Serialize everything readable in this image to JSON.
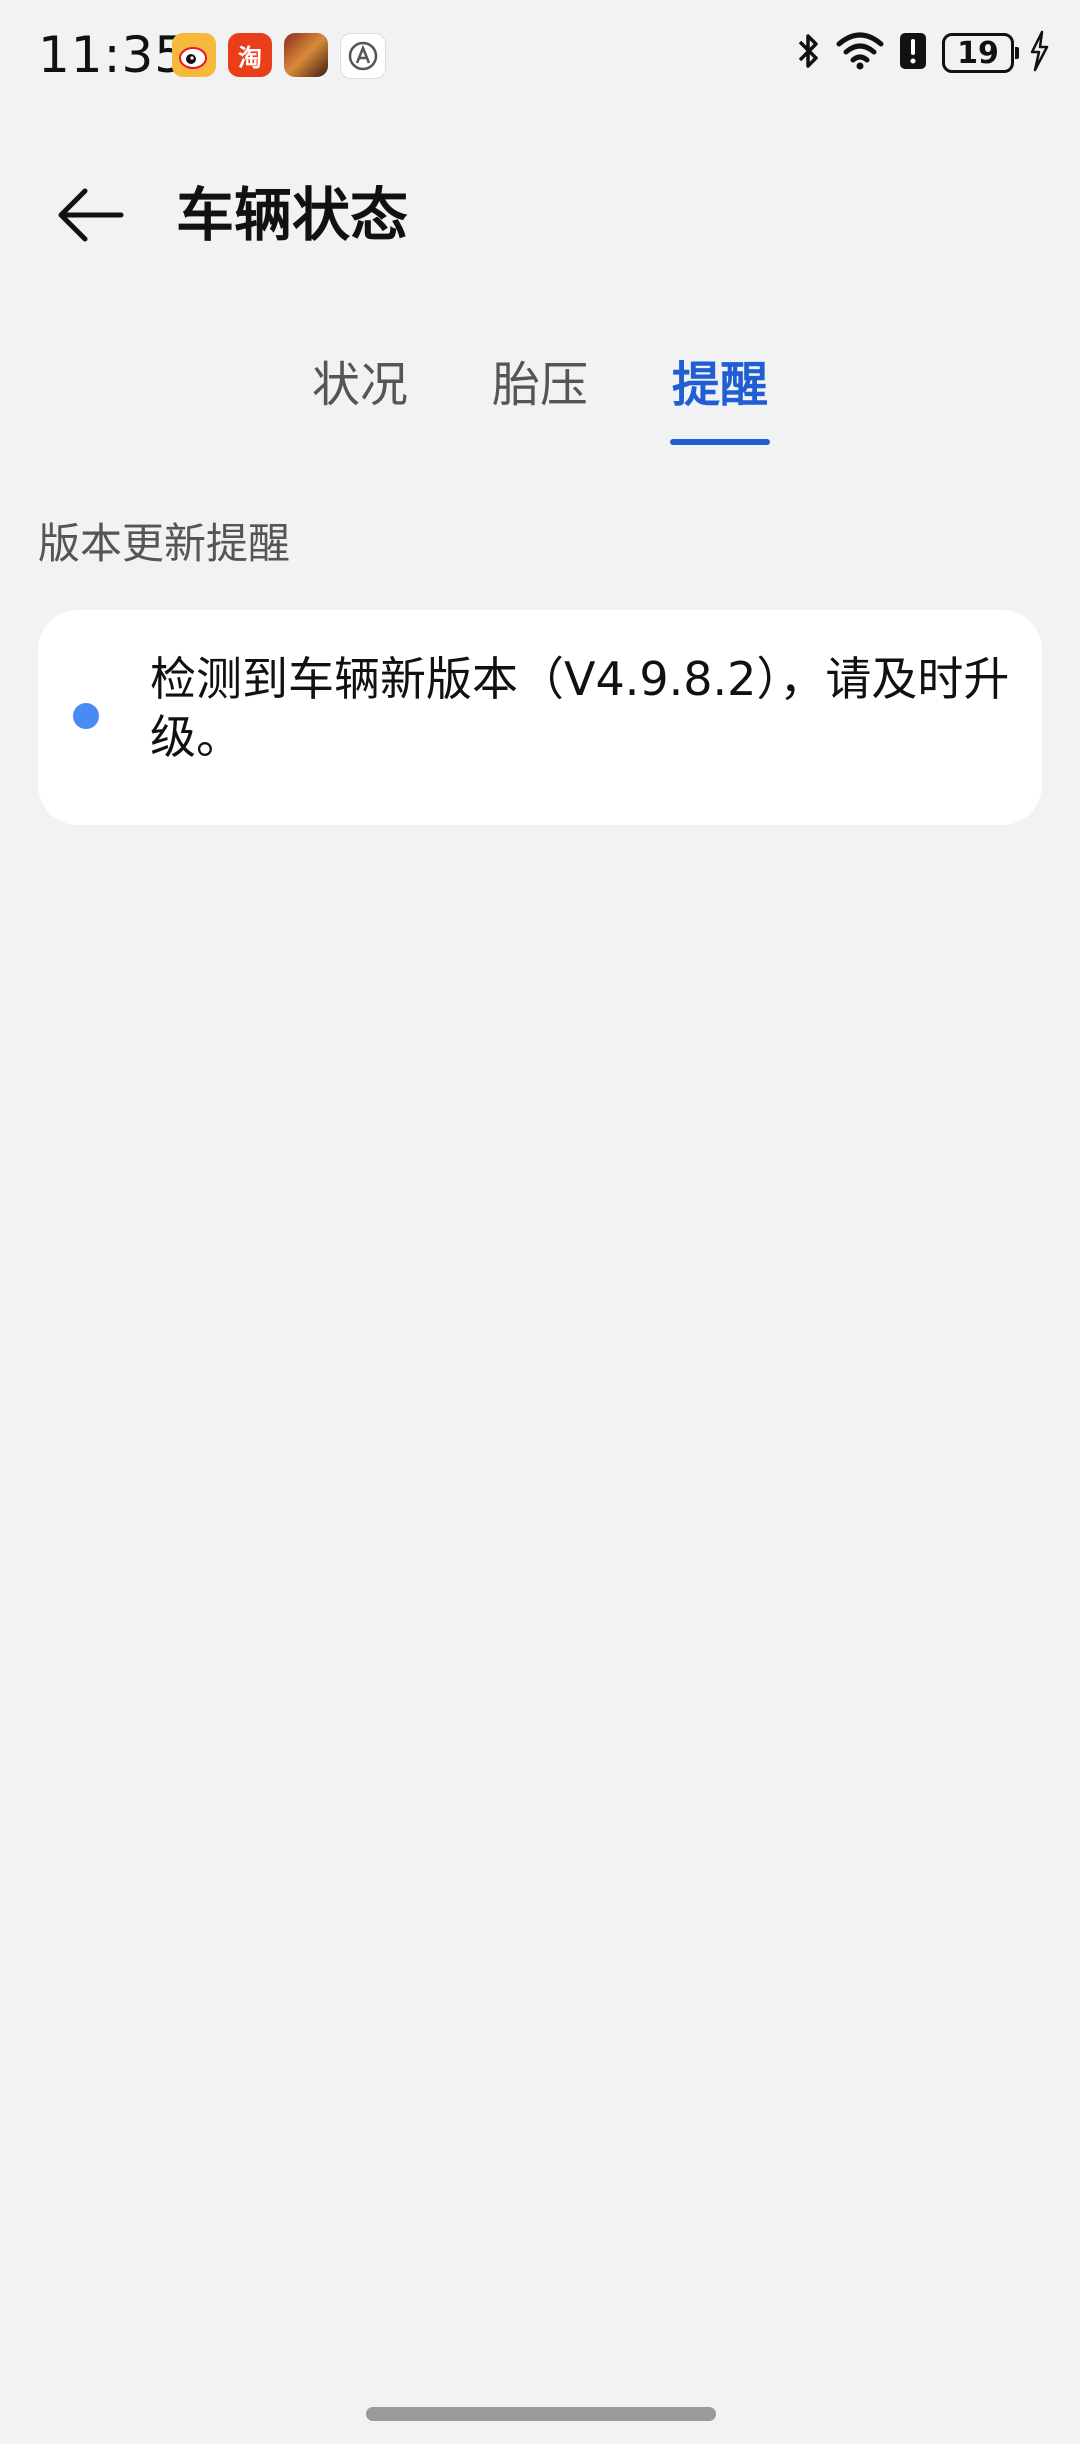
{
  "status_bar": {
    "time": "11:35",
    "taobao_label": "淘",
    "battery_level": "19",
    "icons": [
      "bluetooth-icon",
      "wifi-icon",
      "alert-icon",
      "battery-icon",
      "charging-icon"
    ]
  },
  "header": {
    "title": "车辆状态"
  },
  "tabs": [
    {
      "label": "状况",
      "active": false
    },
    {
      "label": "胎压",
      "active": false
    },
    {
      "label": "提醒",
      "active": true
    }
  ],
  "section": {
    "label": "版本更新提醒",
    "items": [
      {
        "text": "检测到车辆新版本（V4.9.8.2），请及时升级。"
      }
    ]
  },
  "colors": {
    "accent": "#1f5fd1",
    "bullet": "#4a8af4",
    "background": "#f1f2f4"
  }
}
